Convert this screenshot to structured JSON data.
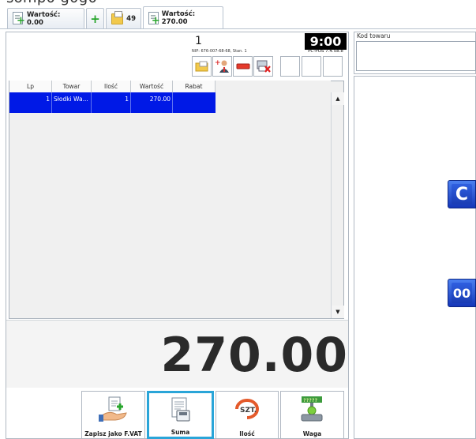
{
  "top_crop_text": "somp0 g0g0",
  "tabs": [
    {
      "label": "Wartość: 0.00"
    },
    {
      "label": ""
    },
    {
      "label": "49"
    },
    {
      "label": "Wartość: 270.00"
    }
  ],
  "receipt_header": {
    "number": "1",
    "nip_line": "NIP: 676-007-68-68, Stan. 1",
    "clock": "9:00",
    "version": "PC-POS 7.4.58.8"
  },
  "toolbar_icons": [
    "folder-icon",
    "customer-icon",
    "remove-icon",
    "cancel-print-icon",
    "",
    "",
    ""
  ],
  "table": {
    "columns": [
      "Lp",
      "Towar",
      "Ilość",
      "Wartość",
      "Rabat"
    ],
    "rows": [
      {
        "lp": "1",
        "towar": "Słodki Wa...",
        "ilosc": "1",
        "wartosc": "270.00",
        "rabat": ""
      }
    ]
  },
  "total": "270.00",
  "actions": [
    {
      "label": "Zapisz jako F.VAT"
    },
    {
      "label": "Suma"
    },
    {
      "label": "Ilość"
    },
    {
      "label": "Waga"
    }
  ],
  "right": {
    "kod_label": "Kod towaru",
    "kod_value": "",
    "key_c": "C",
    "key_00": "00"
  },
  "colors": {
    "selection": "#0019e6",
    "active_action_border": "#2aa5d8",
    "key_blue": "#1a3cb3"
  }
}
